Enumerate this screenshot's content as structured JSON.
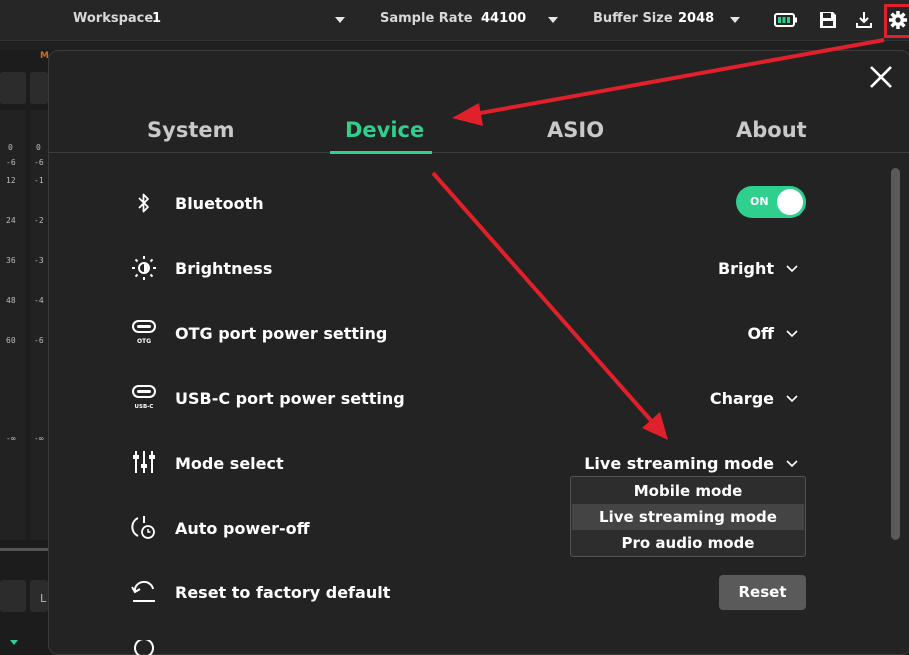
{
  "topbar": {
    "workspace_label": "Workspace",
    "workspace_value": "1",
    "sample_rate_label": "Sample Rate",
    "sample_rate_value": "44100",
    "buffer_size_label": "Buffer Size",
    "buffer_size_value": "2048"
  },
  "background": {
    "channel_marker": "M",
    "meter_scale_1": [
      "0",
      "-6",
      "12",
      "24",
      "36",
      "48",
      "60",
      "-∞"
    ],
    "meter_scale_2": [
      "0",
      "-6",
      "-1",
      "-2",
      "-3",
      "-4",
      "-6",
      "-∞"
    ],
    "bottom_letter": "L"
  },
  "tabs": [
    "System",
    "Device",
    "ASIO",
    "About"
  ],
  "active_tab": "Device",
  "settings": {
    "bluetooth": {
      "label": "Bluetooth",
      "toggle_text": "ON",
      "icon": "bluetooth-icon"
    },
    "brightness": {
      "label": "Brightness",
      "value": "Bright",
      "icon": "brightness-icon"
    },
    "otg": {
      "label": "OTG port power setting",
      "value": "Off",
      "icon": "otg-port-icon",
      "icon_caption": "OTG"
    },
    "usbc": {
      "label": "USB-C port power setting",
      "value": "Charge",
      "icon": "usbc-port-icon",
      "icon_caption": "USB-C"
    },
    "mode": {
      "label": "Mode select",
      "value": "Live streaming mode",
      "icon": "mixer-sliders-icon",
      "options": [
        "Mobile mode",
        "Live streaming mode",
        "Pro audio mode"
      ],
      "selected_index": 1
    },
    "auto_power_off": {
      "label": "Auto power-off",
      "icon": "power-timer-icon"
    },
    "factory_reset": {
      "label": "Reset to factory default",
      "button_label": "Reset",
      "icon": "undo-icon"
    }
  },
  "colors": {
    "accent": "#2fcf8e",
    "annotation": "#e0202a",
    "modal_bg": "#232323"
  }
}
